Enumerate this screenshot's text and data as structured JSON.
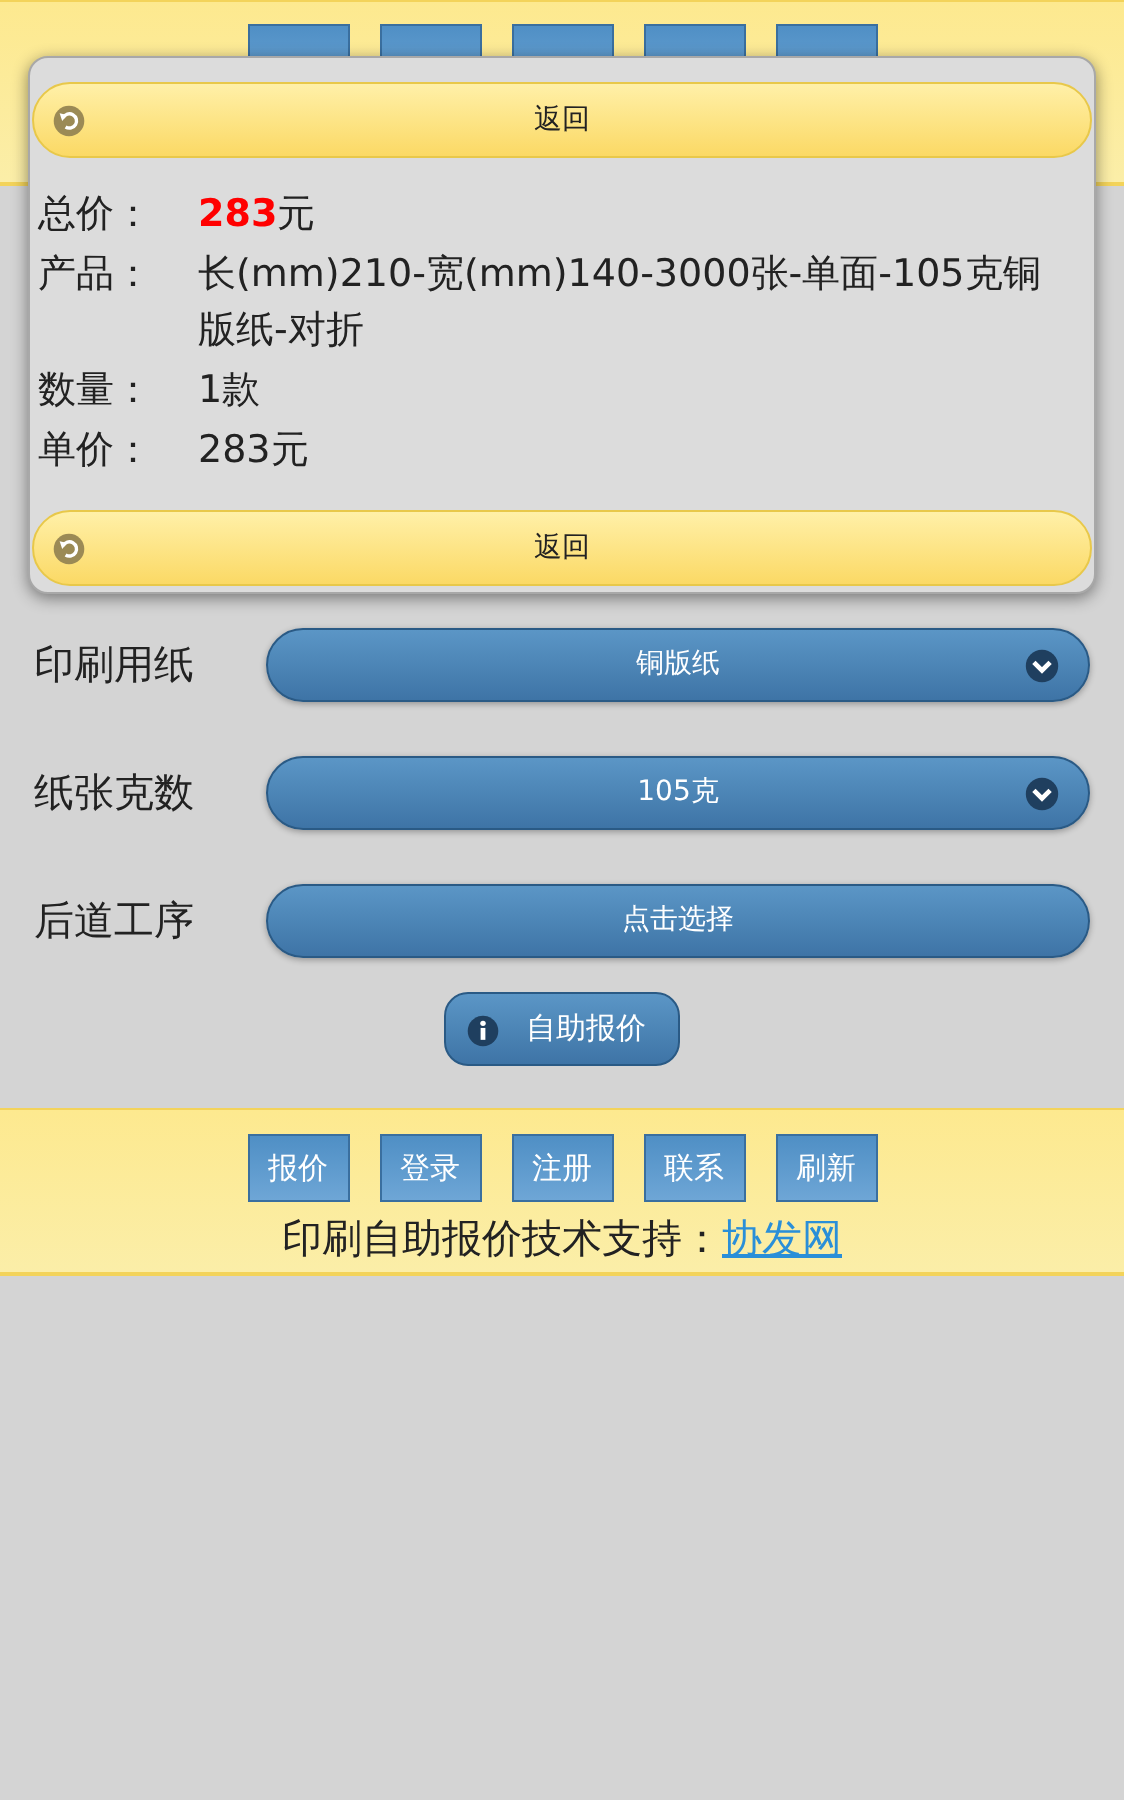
{
  "popup": {
    "back_button_top": "返回",
    "details": [
      {
        "label": "总价：",
        "value": "**283**元"
      },
      {
        "label": "产品：",
        "value": "长(mm)210-宽(mm)140-3000张-单面-105克铜版纸-对折"
      },
      {
        "label": "数量：",
        "value": "1款"
      },
      {
        "label": "单价：",
        "value": "283元"
      }
    ],
    "back_button_bottom": "返回"
  },
  "form": [
    {
      "label": "印刷用纸",
      "kind": "select",
      "value": "铜版纸"
    },
    {
      "label": "纸张克数",
      "kind": "select",
      "value": "105克"
    },
    {
      "label": "后道工序",
      "kind": "button",
      "value": "点击选择"
    }
  ],
  "quote_button": "自助报价",
  "footer": {
    "nav": [
      "报价",
      "登录",
      "注册",
      "联系",
      "刷新"
    ],
    "support_text": "印刷自助报价技术支持：",
    "support_link": "协发网"
  }
}
